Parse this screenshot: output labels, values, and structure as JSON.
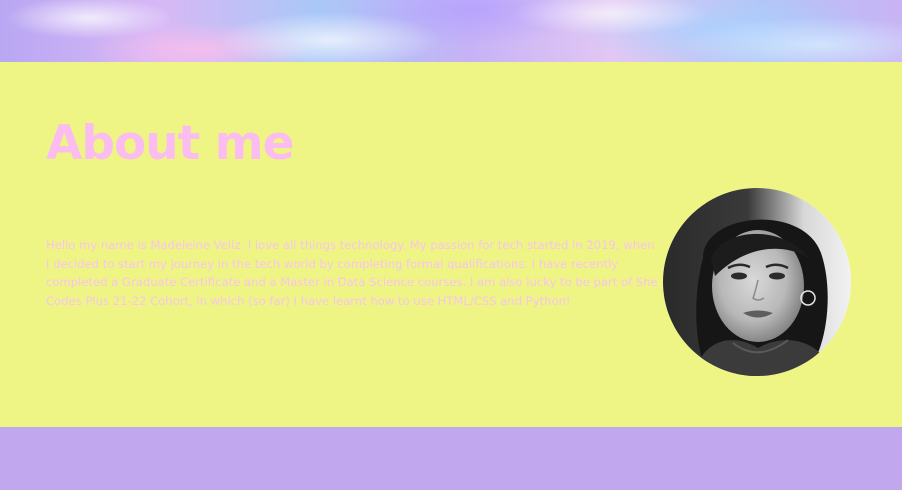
{
  "about": {
    "title": "About me",
    "text": "Hello my name is Madeleine Veliz. I love all things technology. My passion for tech started in 2019, when I decided to start my journey in the tech world by completing formal qualifications. I have recently completed a Graduate Certificate and a Master in Data Science courses. I am also lucky to be part of She Codes Plus 21-22 Cohort, in which (so far) I have learnt how to use HTML/CSS and Python!"
  },
  "colors": {
    "section_background": "#eef585",
    "title_color": "#fbbdf0",
    "text_color": "#f7c5ee",
    "bottom_band": "#c1a7ed"
  },
  "images": {
    "banner": "holographic-banner",
    "profile": "profile-photo"
  }
}
